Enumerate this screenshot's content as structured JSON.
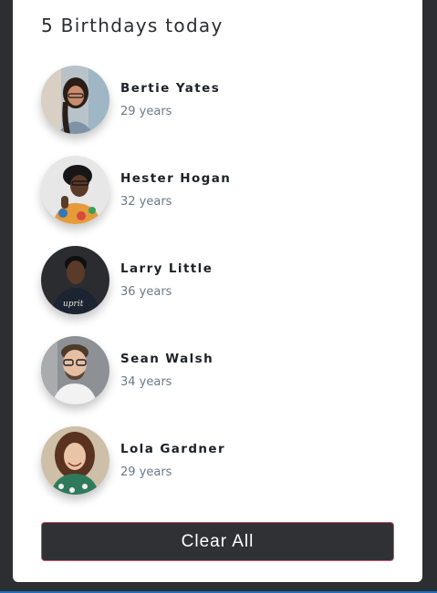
{
  "card": {
    "title": "5 Birthdays today",
    "people": [
      {
        "name": "Bertie Yates",
        "age": "29 years"
      },
      {
        "name": "Hester Hogan",
        "age": "32 years"
      },
      {
        "name": "Larry Little",
        "age": "36 years"
      },
      {
        "name": "Sean Walsh",
        "age": "34 years"
      },
      {
        "name": "Lola Gardner",
        "age": "29 years"
      }
    ],
    "clear_label": "Clear All"
  },
  "colors": {
    "background": "#2d2e31",
    "card": "#ffffff",
    "button": "#2f3135",
    "button_border": "#c9526b",
    "age_text": "#6a7a89"
  }
}
